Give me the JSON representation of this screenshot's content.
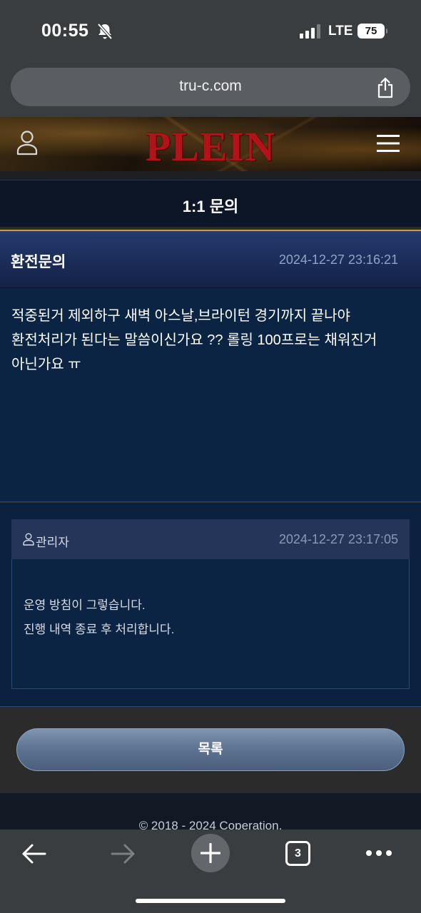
{
  "status_bar": {
    "time": "00:55",
    "network": "LTE",
    "battery": "75"
  },
  "browser": {
    "url": "tru-c.com",
    "tab_count": "3"
  },
  "site": {
    "logo": "PLEIN",
    "page_title": "1:1 문의"
  },
  "inquiry": {
    "title": "환전문의",
    "date": "2024-12-27 23:16:21",
    "body": "적중된거 제외하구 새벽 아스날,브라이턴 경기까지 끝나야 환전처리가 된다는 말씀이신가요 ?? 롤링 100프로는 채워진거 아닌가요 ㅠ"
  },
  "reply": {
    "author": "관리자",
    "date": "2024-12-27 23:17:05",
    "lines": [
      "운영 방침이 그렇습니다.",
      "진행 내역 종료 후 처리합니다."
    ]
  },
  "actions": {
    "list_label": "목록"
  },
  "footer": {
    "copyright": "© 2018 - 2024 Coperation."
  },
  "colors": {
    "logo_red": "#b0141a",
    "accent_gold": "#c9a12a",
    "panel_navy": "#0b2443"
  }
}
